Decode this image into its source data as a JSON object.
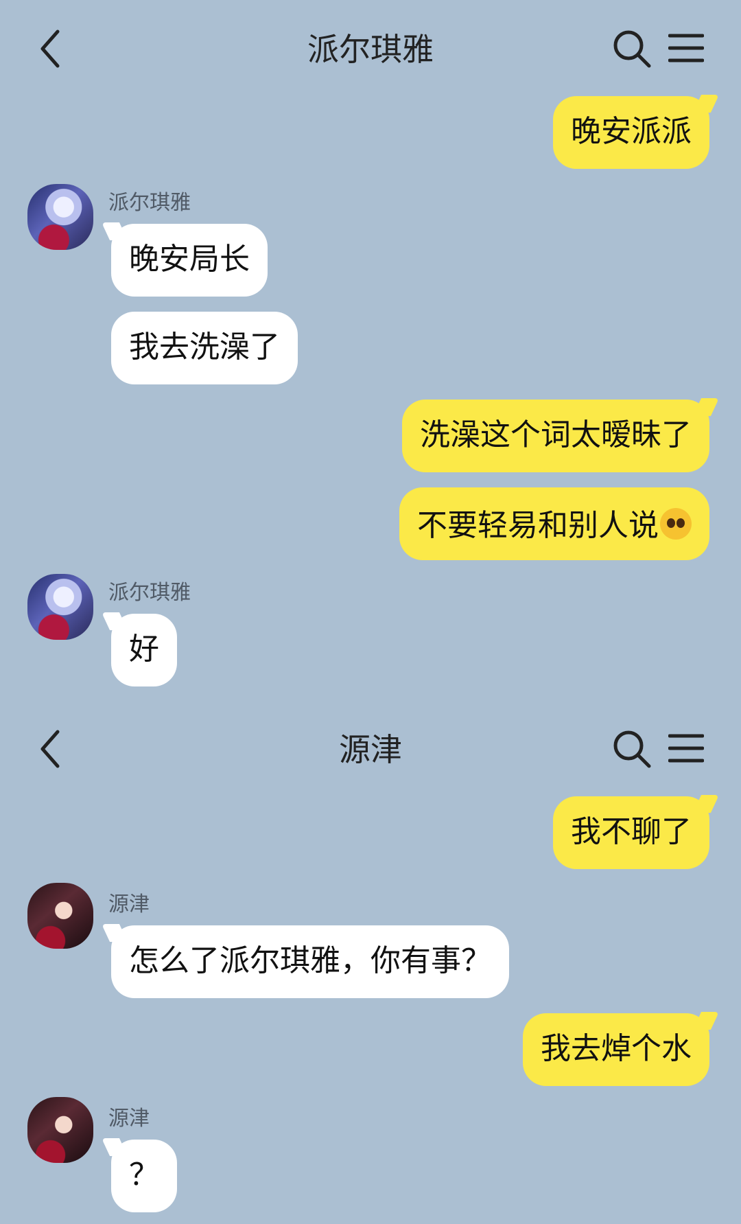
{
  "chats": [
    {
      "title": "派尔琪雅",
      "messages": [
        {
          "side": "out",
          "text": "晚安派派"
        },
        {
          "side": "in",
          "sender": "派尔琪雅",
          "text": "晚安局长"
        },
        {
          "side": "in",
          "text": "我去洗澡了"
        },
        {
          "side": "out",
          "text": "洗澡这个词太暧昧了"
        },
        {
          "side": "out",
          "text": "不要轻易和别人说",
          "emoji": "pleading-face-emoji"
        },
        {
          "side": "in",
          "sender": "派尔琪雅",
          "text": "好"
        }
      ]
    },
    {
      "title": "源津",
      "messages": [
        {
          "side": "out",
          "text": "我不聊了"
        },
        {
          "side": "in",
          "sender": "源津",
          "text": "怎么了派尔琪雅，你有事？"
        },
        {
          "side": "out",
          "text": "我去焯个水"
        },
        {
          "side": "in",
          "sender": "源津",
          "text": "？"
        }
      ]
    }
  ],
  "icons": {
    "back": "chevron-left-icon",
    "search": "search-icon",
    "menu": "hamburger-menu-icon"
  },
  "colors": {
    "background": "#abbfd2",
    "outgoing_bubble": "#fbe948",
    "incoming_bubble": "#ffffff"
  }
}
